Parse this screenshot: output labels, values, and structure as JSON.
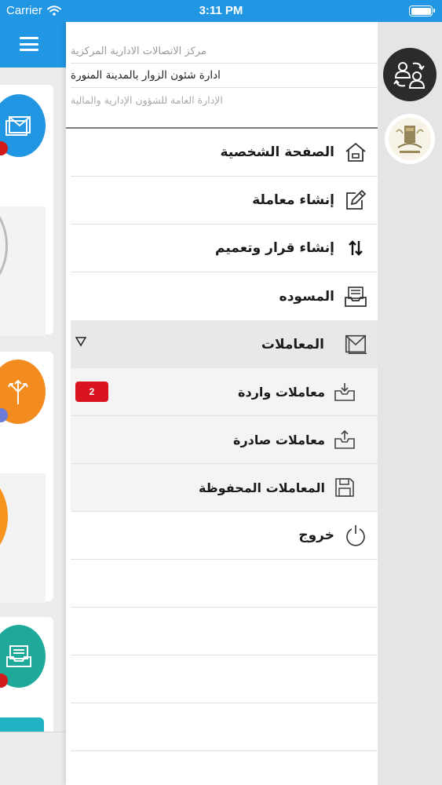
{
  "status_bar": {
    "carrier": "Carrier",
    "time": "3:11 PM"
  },
  "header": {
    "line1": "مركز الاتصالات الادارية المركزية",
    "line2": "ادارة شئون الزوار بالمدينة المنورة",
    "line3": "الإدارة العامة للشؤون الإدارية والمالية"
  },
  "menu": {
    "profile": "الصفحة الشخصية",
    "new_transaction": "إنشاء معاملة",
    "new_decision": "إنشاء قرار وتعميم",
    "drafts": "المسوده",
    "transactions": "المعاملات",
    "incoming": "معاملات واردة",
    "incoming_count": "2",
    "outgoing": "معاملات صادرة",
    "saved": "المعاملات المحفوظة",
    "logout": "خروج"
  },
  "icons": {
    "profile": "home-icon",
    "new_transaction": "edit-icon",
    "new_decision": "swap-vertical-icon",
    "drafts": "inbox-tray-icon",
    "transactions": "envelope-icon",
    "incoming": "tray-download-icon",
    "outgoing": "tray-upload-icon",
    "saved": "floppy-disk-icon",
    "logout": "power-icon",
    "rail_switch": "switch-users-icon",
    "rail_logo": "organization-logo",
    "menu": "hamburger-icon"
  },
  "colors": {
    "status_bar": "#2196e3",
    "badge": "#d9141e",
    "rail": "#e5e5e5",
    "selected_row": "#e8e8e8",
    "sub_row": "#f4f4f4"
  }
}
